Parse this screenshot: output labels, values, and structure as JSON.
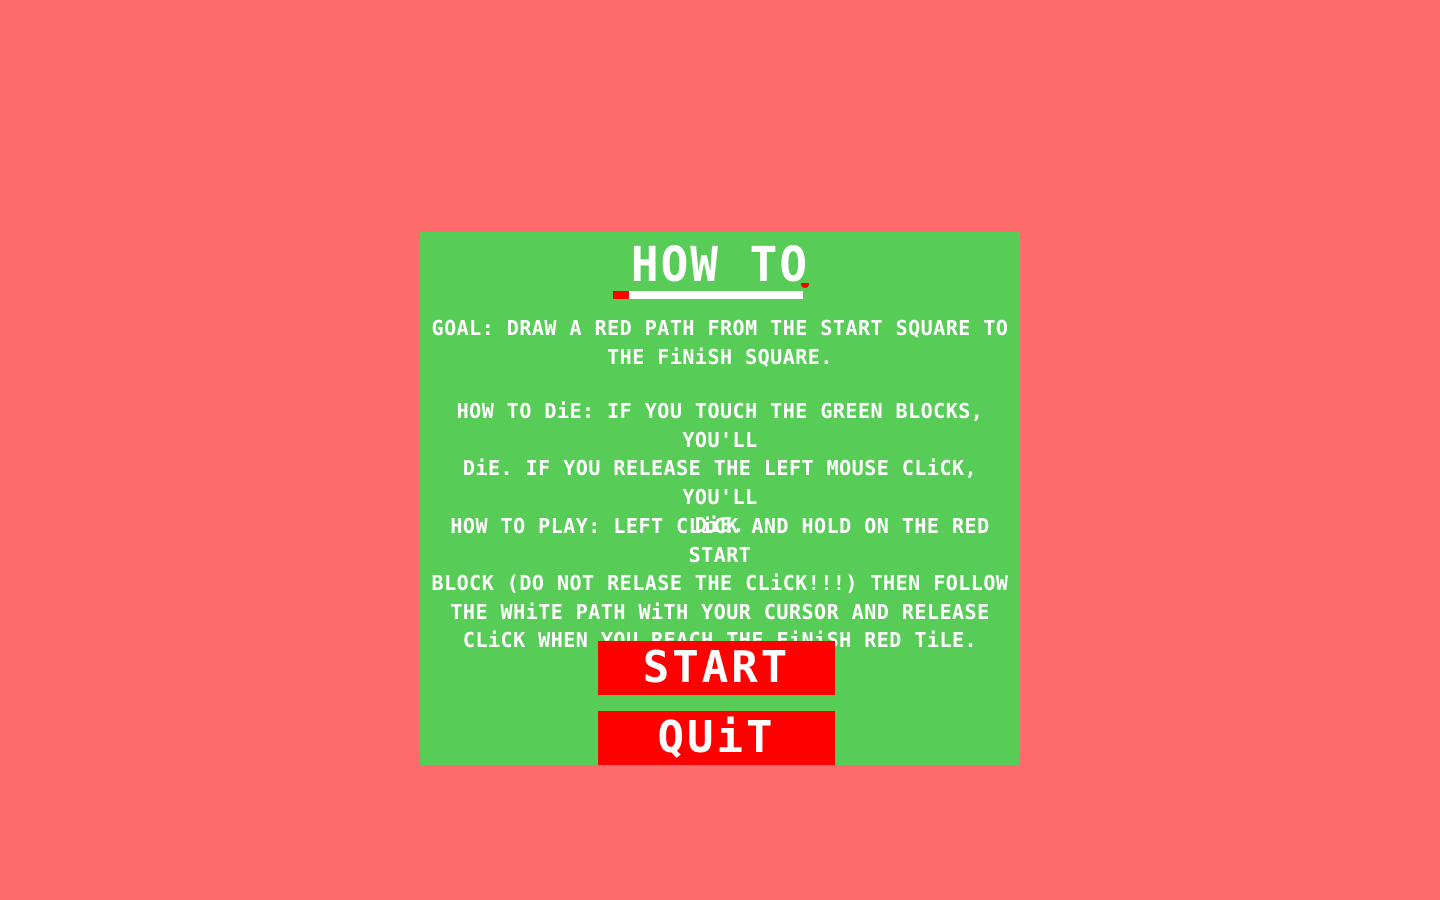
{
  "screen": {
    "background_color": "#ff6a6a",
    "panel_color": "#57cc57",
    "accent_red": "#ff0000",
    "text_color": "#ffffff"
  },
  "howto": {
    "title": "HOW TO",
    "goal": "GOAL: DRAW A RED PATH FROM THE START SQUARE TO\nTHE FiNiSH SQUARE.",
    "die": "HOW TO DiE: IF YOU TOUCH THE GREEN BLOCKS, YOU'LL\nDiE. IF YOU RELEASE THE LEFT MOUSE CLiCK, YOU'LL\nDiE.",
    "play": "HOW TO PLAY: LEFT CLiCK AND HOLD ON THE RED START\nBLOCK (DO NOT RELASE THE CLiCK!!!) THEN FOLLOW\nTHE WHiTE PATH WiTH YOUR CURSOR AND RELEASE\nCLiCK WHEN YOU REACH THE FiNiSH RED TiLE."
  },
  "buttons": {
    "start_label": "START",
    "quit_label": "QUiT"
  }
}
